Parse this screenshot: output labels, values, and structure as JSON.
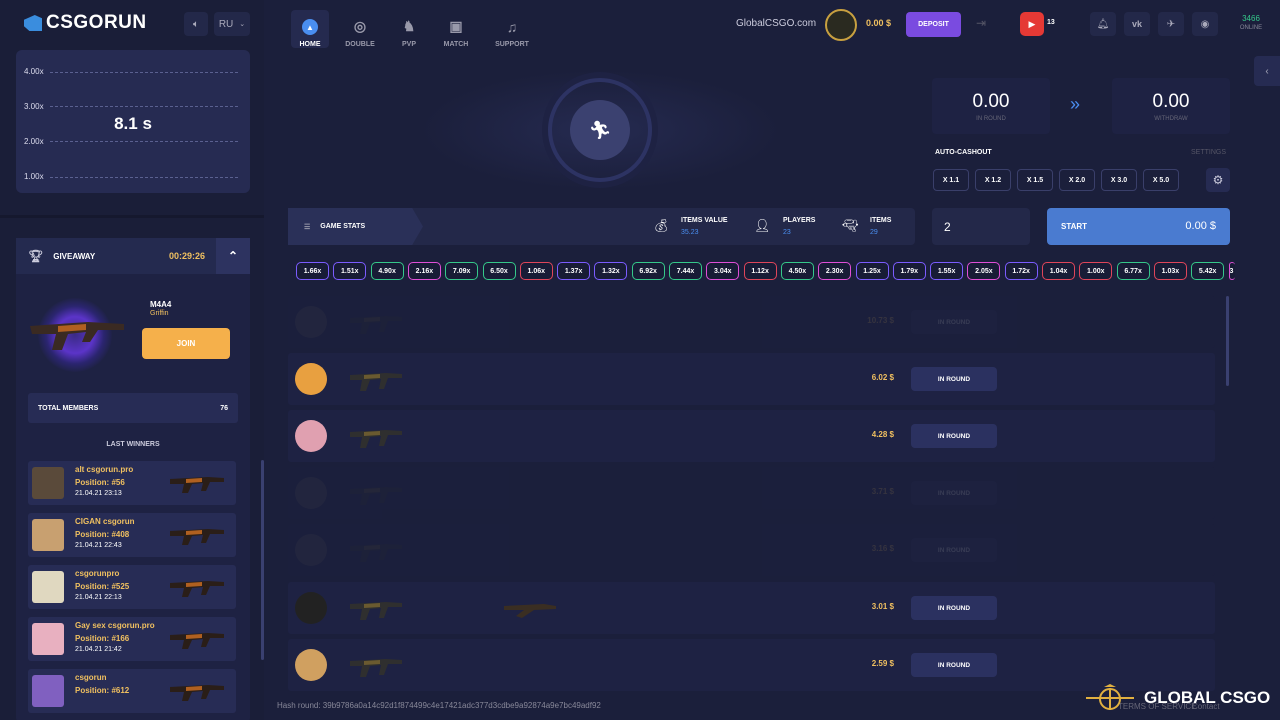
{
  "sidebar": {
    "logo": "CSGORUN",
    "lang": "RU",
    "graph": {
      "timer": "8.1 s",
      "labels": [
        "4.00x",
        "3.00x",
        "2.00x",
        "1.00x"
      ]
    },
    "giveaway": {
      "title": "GIVEAWAY",
      "timer": "00:29:26",
      "item_name": "M4A4",
      "item_skin": "Griffin",
      "join": "JOIN",
      "members_label": "TOTAL MEMBERS",
      "members_count": "76",
      "last_winners_label": "LAST WINNERS",
      "winners": [
        {
          "name": "alt csgorun.pro",
          "position": "Position: #56",
          "date": "21.04.21 23:13",
          "color": "#5a4a3a"
        },
        {
          "name": "CIGAN csgorun",
          "position": "Position: #408",
          "date": "21.04.21 22:43",
          "color": "#c8a070"
        },
        {
          "name": "csgorunpro",
          "position": "Position: #525",
          "date": "21.04.21 22:13",
          "color": "#e0d8c0"
        },
        {
          "name": "Gay sex csgorun.pro",
          "position": "Position: #166",
          "date": "21.04.21 21:42",
          "color": "#e8b0c0"
        },
        {
          "name": "csgorun",
          "position": "Position: #612",
          "date": "",
          "color": "#8060c0"
        }
      ]
    }
  },
  "nav": {
    "items": [
      {
        "label": "HOME",
        "icon": "▲"
      },
      {
        "label": "DOUBLE",
        "icon": "◎"
      },
      {
        "label": "PVP",
        "icon": "♞"
      },
      {
        "label": "MATCH",
        "icon": "▣"
      },
      {
        "label": "SUPPORT",
        "icon": "♫"
      }
    ],
    "site": "GlobalCSGO.com",
    "balance": "0.00 $",
    "deposit": "DEPOSIT",
    "youtube_count": "13",
    "online_count": "3466",
    "online_label": "ONLINE"
  },
  "game": {
    "in_round_value": "0.00",
    "in_round_label": "IN ROUND",
    "withdraw_value": "0.00",
    "withdraw_label": "WITHDRAW",
    "auto_cashout": "AUTO-CASHOUT",
    "settings": "SETTINGS",
    "multipliers": [
      "X 1.1",
      "X 1.2",
      "X 1.5",
      "X 2.0",
      "X 3.0",
      "X 5.0"
    ],
    "stats_label": "GAME STATS",
    "items_value_label": "ITEMS VALUE",
    "items_value": "35.23",
    "players_label": "PLAYERS",
    "players": "23",
    "items_label": "ITEMS",
    "items": "29",
    "bet_input": "2",
    "start_label": "START",
    "start_value": "0.00 $"
  },
  "history": [
    {
      "v": "1.66x",
      "c": "#7b5cff"
    },
    {
      "v": "1.51x",
      "c": "#7b5cff"
    },
    {
      "v": "4.90x",
      "c": "#35c88a"
    },
    {
      "v": "2.16x",
      "c": "#e04fd8"
    },
    {
      "v": "7.09x",
      "c": "#35c88a"
    },
    {
      "v": "6.50x",
      "c": "#35c88a"
    },
    {
      "v": "1.06x",
      "c": "#e0455a"
    },
    {
      "v": "1.37x",
      "c": "#7b5cff"
    },
    {
      "v": "1.32x",
      "c": "#7b5cff"
    },
    {
      "v": "6.92x",
      "c": "#35c88a"
    },
    {
      "v": "7.44x",
      "c": "#35c88a"
    },
    {
      "v": "3.04x",
      "c": "#e04fd8"
    },
    {
      "v": "1.12x",
      "c": "#e0455a"
    },
    {
      "v": "4.50x",
      "c": "#35c88a"
    },
    {
      "v": "2.30x",
      "c": "#e04fd8"
    },
    {
      "v": "1.25x",
      "c": "#7b5cff"
    },
    {
      "v": "1.79x",
      "c": "#7b5cff"
    },
    {
      "v": "1.55x",
      "c": "#7b5cff"
    },
    {
      "v": "2.05x",
      "c": "#e04fd8"
    },
    {
      "v": "1.72x",
      "c": "#7b5cff"
    },
    {
      "v": "1.04x",
      "c": "#e0455a"
    },
    {
      "v": "1.00x",
      "c": "#e0455a"
    },
    {
      "v": "6.77x",
      "c": "#35c88a"
    },
    {
      "v": "1.03x",
      "c": "#e0455a"
    },
    {
      "v": "5.42x",
      "c": "#35c88a"
    },
    {
      "v": "3",
      "c": "#e04fd8"
    }
  ],
  "bets": [
    {
      "value": "10.73 $",
      "btn": "IN ROUND",
      "faded": true,
      "color": "#555"
    },
    {
      "value": "6.02 $",
      "btn": "IN ROUND",
      "faded": false,
      "color": "#e8a040"
    },
    {
      "value": "4.28 $",
      "btn": "IN ROUND",
      "faded": false,
      "color": "#e0a0b0"
    },
    {
      "value": "3.71 $",
      "btn": "IN ROUND",
      "faded": true,
      "color": "#555"
    },
    {
      "value": "3.16 $",
      "btn": "IN ROUND",
      "faded": true,
      "color": "#555"
    },
    {
      "value": "3.01 $",
      "btn": "IN ROUND",
      "faded": false,
      "color": "#222"
    },
    {
      "value": "2.59 $",
      "btn": "IN ROUND",
      "faded": false,
      "color": "#d0a060"
    }
  ],
  "footer": {
    "hash": "Hash round: 39b9786a0a14c92d1f874499c4e17421adc377d3cdbe9a92874a9e7bc49adf92",
    "terms": "TERMS OF SERVICE",
    "contact": "Contact",
    "watermark": "GLOBAL CSGO"
  }
}
